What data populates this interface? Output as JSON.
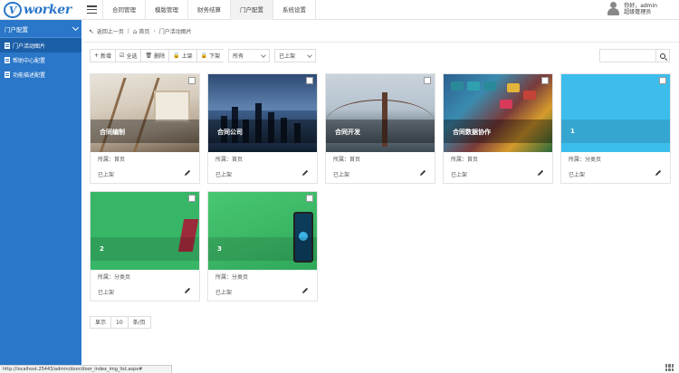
{
  "header": {
    "logo_letter": "V",
    "logo_text": "worker",
    "tabs": [
      {
        "label": "合同管理"
      },
      {
        "label": "模版管理"
      },
      {
        "label": "财务结算"
      },
      {
        "label": "门户配置"
      },
      {
        "label": "系统设置"
      }
    ],
    "user": {
      "line1": "你好，admin",
      "line2": "超级管理员"
    }
  },
  "sidebar": {
    "title": "门户配置",
    "items": [
      {
        "label": "门户活动图片"
      },
      {
        "label": "帮助中心配置"
      },
      {
        "label": "功能描述配置"
      }
    ]
  },
  "breadcrumb": {
    "back": "返回上一页",
    "home": "首页",
    "current": "门户活动图片"
  },
  "toolbar": {
    "add": "新增",
    "select_all": "全选",
    "delete": "删除",
    "publish": "上架",
    "unpublish": "下架",
    "filter_position": "所有",
    "filter_status": "已上架",
    "search_placeholder": ""
  },
  "cards": [
    {
      "title": "合同编制",
      "location": "所属：首页",
      "status": "已上架"
    },
    {
      "title": "合同公司",
      "location": "所属：首页",
      "status": "已上架"
    },
    {
      "title": "合同开发",
      "location": "所属：首页",
      "status": "已上架"
    },
    {
      "title": "合同数据协作",
      "location": "所属：首页",
      "status": "已上架"
    },
    {
      "title": "1",
      "location": "所属：分类页",
      "status": "已上架"
    },
    {
      "title": "2",
      "location": "所属：分类页",
      "status": "已上架"
    },
    {
      "title": "3",
      "location": "所属：分类页",
      "status": "已上架"
    }
  ],
  "pager": {
    "show": "显示",
    "size": "10",
    "per_page": "条/页"
  },
  "status_url": "http://localhost:25443/admin/door/door_index_img_list.aspx#",
  "colors": {
    "sidebar": "#2a77c9",
    "sidebar_active": "#1b5fa8"
  }
}
